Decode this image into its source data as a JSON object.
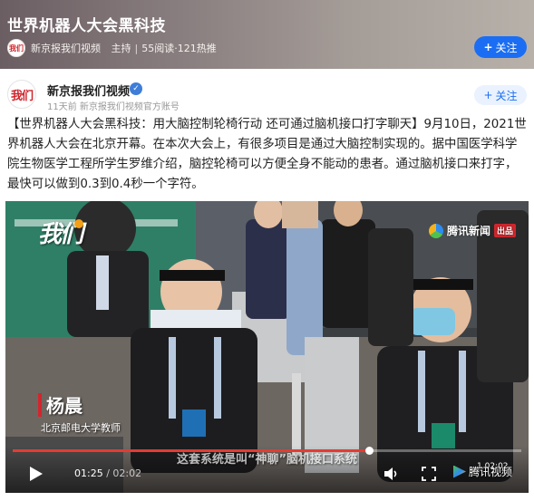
{
  "topic": {
    "title": "世界机器人大会黑科技",
    "source": "新京报我们视频",
    "role": "主持",
    "reads": "55阅读",
    "heat": "121热推",
    "follow_label": "关注",
    "avatar_text": "我们"
  },
  "post": {
    "author": "新京报我们视频",
    "avatar_text": "我们",
    "time": "11天前",
    "account_desc": "新京报我们视频官方账号",
    "follow_label": "关注",
    "text": "【世界机器人大会黑科技：用大脑控制轮椅行动 还可通过脑机接口打字聊天】9月10日，2021世界机器人大会在北京开幕。在本次大会上，有很多项目是通过大脑控制实现的。据中国医学科学院生物医学工程所学生罗维介绍，脑控轮椅可以方便全身不能动的患者。通过脑机接口来打字，最快可以做到0.3到0.4秒一个字符。"
  },
  "video": {
    "watermark_left": "我们",
    "watermark_right": "腾讯新闻",
    "watermark_badge": "出品",
    "caption_name": "杨晨",
    "caption_title": "北京邮电大学教师",
    "subtitle": "这套系统是叫“神聊”脑机接口系统",
    "current_time": "01:25",
    "duration": "02:02",
    "mini_time": "1 02:02",
    "brand": "腾讯视频",
    "progress": 0.7
  },
  "colors": {
    "accent": "#1b6ef3",
    "brand_red": "#d0262d",
    "progress": "#e33c33"
  },
  "icons": {
    "play": "play-icon",
    "volume": "volume-icon",
    "fullscreen": "fullscreen-icon",
    "verified": "verified-icon",
    "plus": "plus-icon"
  }
}
